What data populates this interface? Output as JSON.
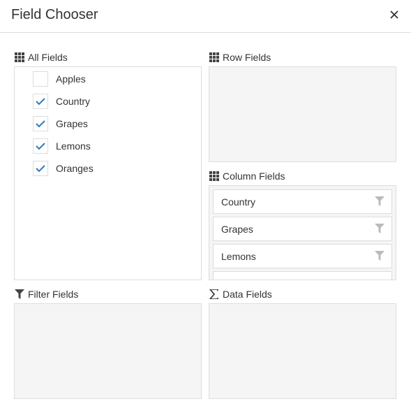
{
  "dialog": {
    "title": "Field Chooser",
    "close_icon": "close-icon"
  },
  "all_fields": {
    "label": "All Fields",
    "icon": "grid-icon",
    "items": [
      {
        "label": "Apples",
        "checked": false
      },
      {
        "label": "Country",
        "checked": true
      },
      {
        "label": "Grapes",
        "checked": true
      },
      {
        "label": "Lemons",
        "checked": true
      },
      {
        "label": "Oranges",
        "checked": true
      }
    ]
  },
  "row_fields": {
    "label": "Row Fields",
    "icon": "grid-icon",
    "items": []
  },
  "column_fields": {
    "label": "Column Fields",
    "icon": "grid-icon",
    "items": [
      {
        "label": "Country",
        "icon": "filter-icon"
      },
      {
        "label": "Grapes",
        "icon": "filter-icon"
      },
      {
        "label": "Lemons",
        "icon": "filter-icon"
      }
    ]
  },
  "filter_fields": {
    "label": "Filter Fields",
    "icon": "filter-icon",
    "items": []
  },
  "data_fields": {
    "label": "Data Fields",
    "icon": "sigma-icon",
    "items": []
  },
  "colors": {
    "check": "#337ab7",
    "border": "#dddddd",
    "empty_panel": "#f5f5f5",
    "filter_icon": "#bbbbbb",
    "text": "#333333"
  }
}
